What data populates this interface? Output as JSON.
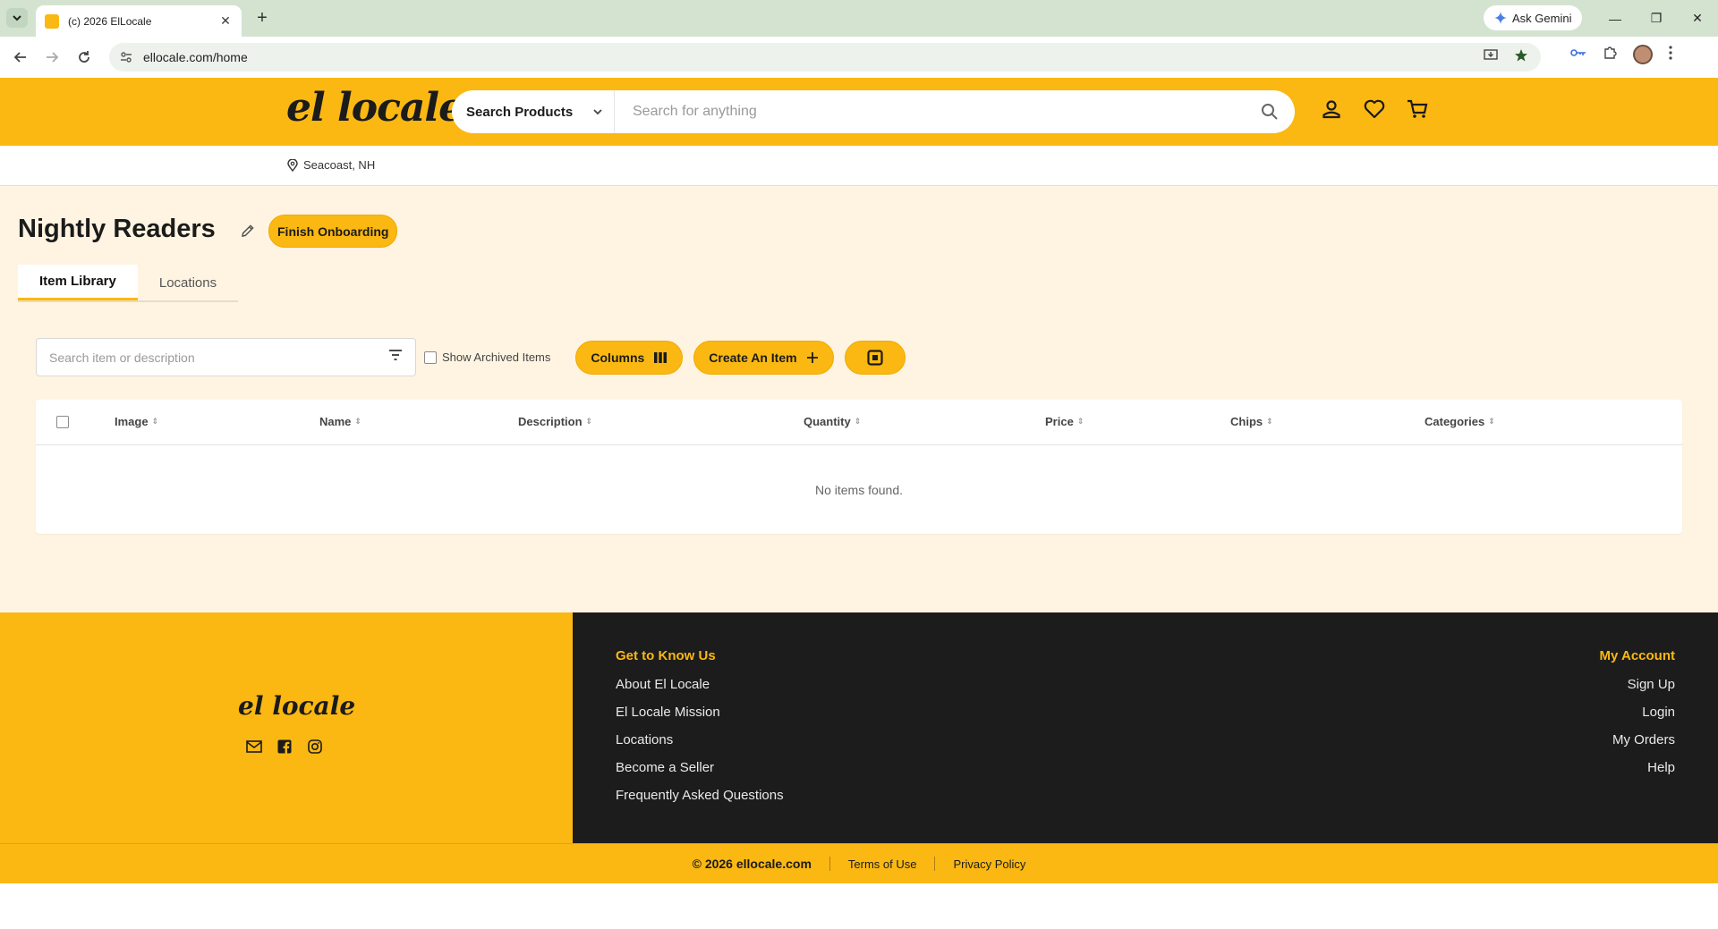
{
  "browser": {
    "tab_title": "(c) 2026 ElLocale",
    "url": "ellocale.com/home",
    "ask_gemini": "Ask Gemini"
  },
  "header": {
    "logo_text": "el locale",
    "search_category": "Search Products",
    "search_placeholder": "Search for anything"
  },
  "location": "Seacoast, NH",
  "store": {
    "title": "Nightly Readers",
    "finish_onboarding": "Finish Onboarding"
  },
  "tabs": [
    "Item Library",
    "Locations"
  ],
  "toolbar": {
    "search_placeholder": "Search item or description",
    "show_archived": "Show Archived Items",
    "columns": "Columns",
    "create_item": "Create An Item"
  },
  "table": {
    "headers": [
      "Image",
      "Name",
      "Description",
      "Quantity",
      "Price",
      "Chips",
      "Categories"
    ],
    "empty": "No items found."
  },
  "footer": {
    "logo_text": "el locale",
    "know_us_heading": "Get to Know Us",
    "know_us_links": [
      "About El Locale",
      "El Locale Mission",
      "Locations",
      "Become a Seller",
      "Frequently Asked Questions"
    ],
    "account_heading": "My Account",
    "account_links": [
      "Sign Up",
      "Login",
      "My Orders",
      "Help"
    ],
    "copyright": "© 2026 ellocale.com",
    "terms": "Terms of Use",
    "privacy": "Privacy Policy"
  },
  "colors": {
    "brand_yellow": "#fbb812",
    "footer_dark": "#1c1c1c",
    "page_cream": "#fff4e2"
  }
}
